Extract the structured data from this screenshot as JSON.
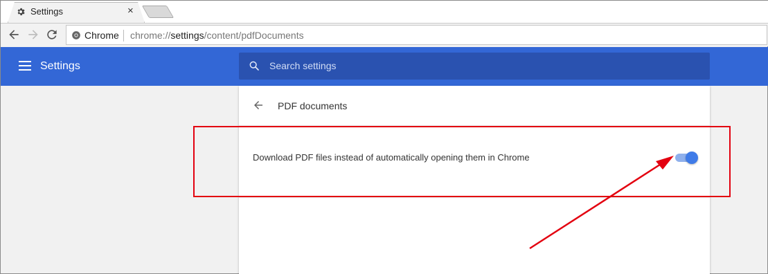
{
  "tab": {
    "title": "Settings",
    "close": "×"
  },
  "toolbar": {
    "omnibox_label": "Chrome",
    "url_prefix": "chrome://",
    "url_host": "settings",
    "url_path": "/content/pdfDocuments"
  },
  "header": {
    "title": "Settings",
    "search_placeholder": "Search settings"
  },
  "page": {
    "title": "PDF documents",
    "setting_label": "Download PDF files instead of automatically opening them in Chrome",
    "toggle_on": true
  },
  "colors": {
    "header": "#3367d6",
    "search": "#2a52b0",
    "toggle_knob": "#3f7be8",
    "annotation": "#e3000f"
  },
  "icons": {
    "tab": "gear-icon",
    "back": "arrow-left-icon",
    "forward": "arrow-right-icon",
    "reload": "reload-icon",
    "omnibox": "chrome-icon",
    "menu": "hamburger-icon",
    "search": "search-icon",
    "page_back": "arrow-left-icon"
  }
}
